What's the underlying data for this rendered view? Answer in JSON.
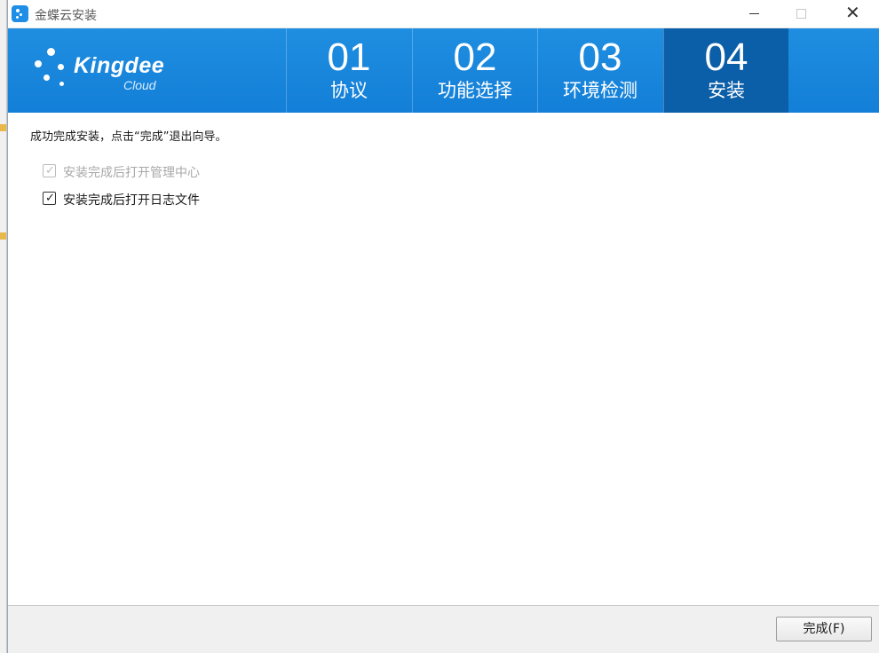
{
  "window": {
    "title": "金蝶云安装"
  },
  "logo": {
    "brand": "Kingdee",
    "sub": "Cloud"
  },
  "steps": [
    {
      "num": "01",
      "label": "协议"
    },
    {
      "num": "02",
      "label": "功能选择"
    },
    {
      "num": "03",
      "label": "环境检测"
    },
    {
      "num": "04",
      "label": "安装"
    }
  ],
  "active_step": "04",
  "content": {
    "message": "成功完成安装，点击“完成”退出向导。",
    "options": [
      {
        "label": "安装完成后打开管理中心",
        "checked": true,
        "disabled": true
      },
      {
        "label": "安装完成后打开日志文件",
        "checked": true,
        "disabled": false
      }
    ]
  },
  "footer": {
    "finish_label": "完成(F)"
  },
  "colors": {
    "banner": "#1f8ee0",
    "active_step": "#0b5ea8"
  }
}
